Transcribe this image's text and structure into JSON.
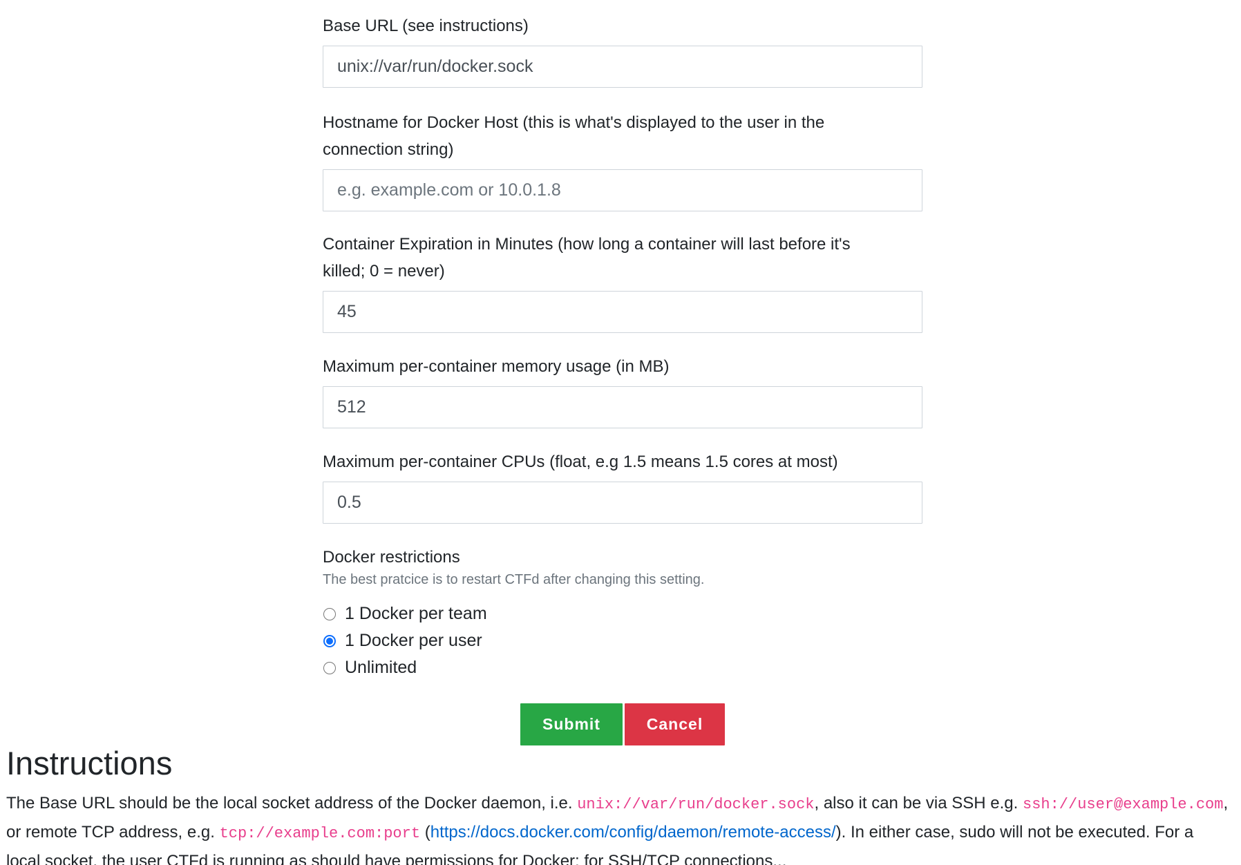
{
  "form": {
    "base_url": {
      "label": "Base URL (see instructions)",
      "value": "unix://var/run/docker.sock"
    },
    "hostname": {
      "label_line1": "Hostname for Docker Host (this is what's displayed to the user in the",
      "label_line2": "connection string)",
      "placeholder": "e.g. example.com or 10.0.1.8",
      "value": ""
    },
    "expiration": {
      "label_line1": "Container Expiration in Minutes (how long a container will last before it's",
      "label_line2": "killed; 0 = never)",
      "value": "45"
    },
    "memory": {
      "label": "Maximum per-container memory usage (in MB)",
      "value": "512"
    },
    "cpus": {
      "label": "Maximum per-container CPUs (float, e.g 1.5 means 1.5 cores at most)",
      "value": "0.5"
    },
    "restrictions": {
      "label": "Docker restrictions",
      "help": "The best pratcice is to restart CTFd after changing this setting.",
      "options": [
        {
          "label": "1 Docker per team",
          "checked": false
        },
        {
          "label": "1 Docker per user",
          "checked": true
        },
        {
          "label": "Unlimited",
          "checked": false
        }
      ]
    },
    "submit_label": "Submit",
    "cancel_label": "Cancel"
  },
  "instructions": {
    "title": "Instructions",
    "text1": "The Base URL should be the local socket address of the Docker daemon, i.e. ",
    "code1": "unix://var/run/docker.sock",
    "text2": ", also it can be via SSH e.g. ",
    "code2": "ssh://user@example.com",
    "text3": ",",
    "text4": "or remote TCP address, e.g. ",
    "code3": "tcp://example.com:port",
    "text5": " (",
    "link": "https://docs.docker.com/config/daemon/remote-access/",
    "text6": "). In either case, sudo will not be executed. For a",
    "text7": "local socket, the user CTFd is running as should have permissions for Docker; for SSH/TCP connections..."
  },
  "colors": {
    "submit": "#28a745",
    "cancel": "#dc3545",
    "code": "#e83e8c",
    "link": "#0066cc",
    "radio_checked": "#0d6efd"
  }
}
